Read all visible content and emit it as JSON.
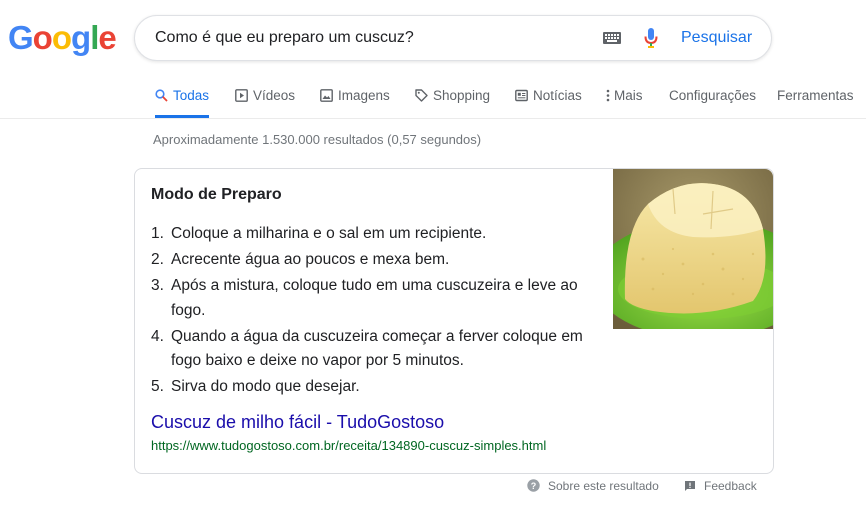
{
  "logo": {
    "letters": [
      {
        "char": "G",
        "color": "#4285F4"
      },
      {
        "char": "o",
        "color": "#EA4335"
      },
      {
        "char": "o",
        "color": "#FBBC05"
      },
      {
        "char": "g",
        "color": "#4285F4"
      },
      {
        "char": "l",
        "color": "#34A853"
      },
      {
        "char": "e",
        "color": "#EA4335"
      }
    ]
  },
  "search": {
    "query": "Como é que eu preparo um cuscuz?",
    "button_label": "Pesquisar",
    "keyboard_icon": "keyboard-icon",
    "mic_icon": "microphone-icon"
  },
  "tabs": [
    {
      "label": "Todas",
      "icon": "search-icon",
      "active": true
    },
    {
      "label": "Vídeos",
      "icon": "video-icon",
      "active": false
    },
    {
      "label": "Imagens",
      "icon": "image-icon",
      "active": false
    },
    {
      "label": "Shopping",
      "icon": "tag-icon",
      "active": false
    },
    {
      "label": "Notícias",
      "icon": "news-icon",
      "active": false
    },
    {
      "label": "Mais",
      "icon": "more-vertical-icon",
      "active": false
    },
    {
      "label": "Configurações",
      "icon": "",
      "active": false
    },
    {
      "label": "Ferramentas",
      "icon": "",
      "active": false
    }
  ],
  "stats": "Aproximadamente 1.530.000 resultados (0,57 segundos)",
  "snippet": {
    "title": "Modo de Preparo",
    "steps": [
      {
        "num": "1.",
        "text": "Coloque a milharina e o sal em um recipiente."
      },
      {
        "num": "2.",
        "text": "Acrecente água ao poucos e mexa bem."
      },
      {
        "num": "3.",
        "text": "Após a mistura, coloque tudo em uma cuscuzeira e leve ao fogo."
      },
      {
        "num": "4.",
        "text": "Quando a água da cuscuzeira começar a ferver coloque em fogo baixo e deixe no vapor por 5 minutos."
      },
      {
        "num": "5.",
        "text": "Sirva do modo que desejar."
      }
    ],
    "source_title": "Cuscuz de milho fácil - TudoGostoso",
    "source_url": "https://www.tudogostoso.com.br/receita/134890-cuscuz-simples.html"
  },
  "footer": {
    "about_label": "Sobre este resultado",
    "feedback_label": "Feedback"
  },
  "colors": {
    "accent": "#1a73e8",
    "link": "#1a0dab",
    "url": "#006621",
    "muted": "#70757a"
  }
}
